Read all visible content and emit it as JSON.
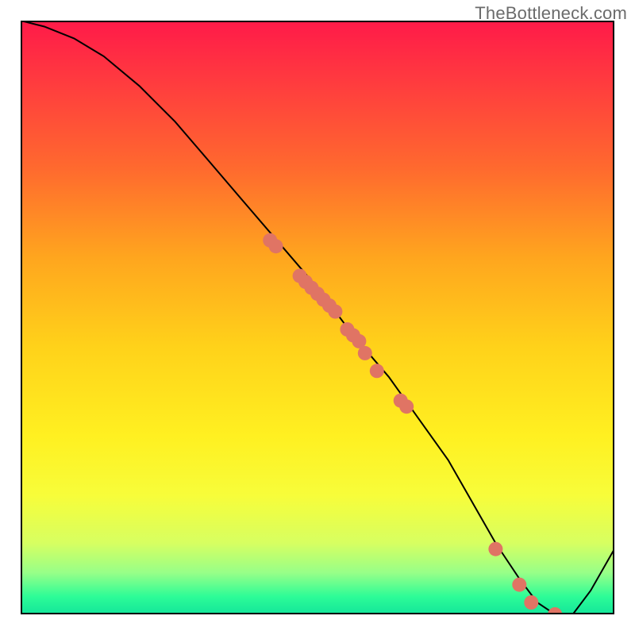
{
  "watermark": "TheBottleneck.com",
  "colors": {
    "dots": "#e07464",
    "curve": "#000000",
    "border": "#000000"
  },
  "chart_data": {
    "type": "line",
    "title": "",
    "xlabel": "",
    "ylabel": "",
    "xlim": [
      0,
      100
    ],
    "ylim": [
      0,
      100
    ],
    "grid": false,
    "legend": false,
    "note": "Axes are unlabeled in the image; values below are normalized 0–100 estimates read from pixel positions. Y is bottleneck-style (high = red/top, low = green/bottom).",
    "series": [
      {
        "name": "curve",
        "kind": "line",
        "x": [
          0,
          4,
          9,
          14,
          20,
          26,
          32,
          38,
          44,
          50,
          56,
          62,
          67,
          72,
          76,
          80,
          84,
          87,
          90,
          93,
          96,
          100
        ],
        "y": [
          100,
          99,
          97,
          94,
          89,
          83,
          76,
          69,
          62,
          55,
          47,
          40,
          33,
          26,
          19,
          12,
          6,
          2,
          0,
          0,
          4,
          11
        ]
      },
      {
        "name": "dots-on-curve",
        "kind": "scatter",
        "x": [
          42,
          43,
          47,
          48,
          49,
          50,
          51,
          52,
          53,
          55,
          56,
          57,
          58,
          60,
          64,
          65,
          80,
          84,
          86,
          90
        ],
        "y": [
          63,
          62,
          57,
          56,
          55,
          54,
          53,
          52,
          51,
          48,
          47,
          46,
          44,
          41,
          36,
          35,
          11,
          5,
          2,
          0
        ]
      }
    ]
  }
}
